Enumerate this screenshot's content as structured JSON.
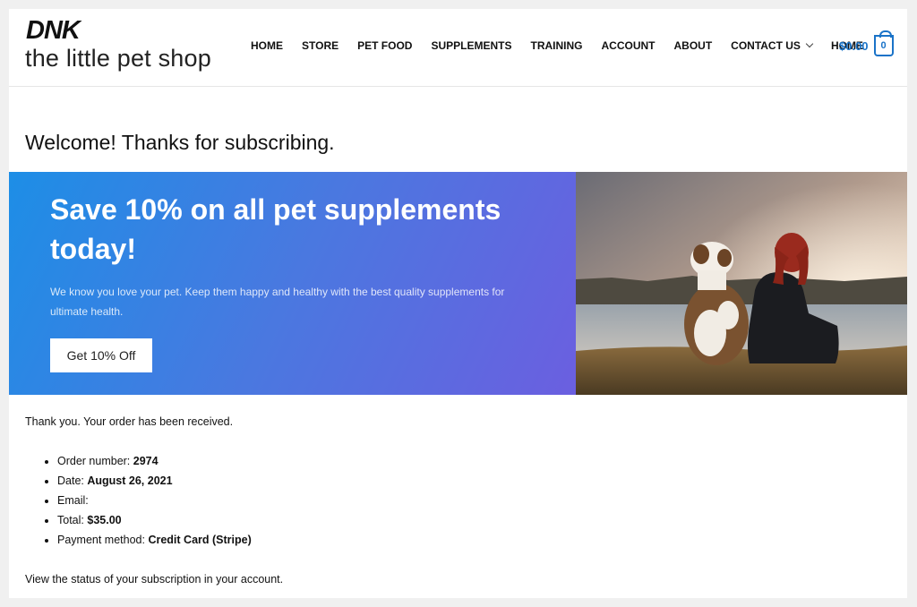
{
  "logo": {
    "text": "DNK"
  },
  "site_title": "the little pet shop",
  "nav": {
    "items": [
      "HOME",
      "STORE",
      "PET FOOD",
      "SUPPLEMENTS",
      "TRAINING",
      "ACCOUNT",
      "ABOUT",
      "CONTACT US",
      "HOME"
    ]
  },
  "cart": {
    "total": "$0.00",
    "count": "0"
  },
  "welcome_heading": "Welcome! Thanks for subscribing.",
  "banner": {
    "heading": "Save 10% on all pet supplements today!",
    "text": "We know you love your pet. Keep them happy and healthy with the best quality supplements for ultimate health.",
    "button_label": "Get 10% Off"
  },
  "order": {
    "thanks": "Thank you. Your order has been received.",
    "number_label": "Order number:",
    "number_value": "2974",
    "date_label": "Date:",
    "date_value": "August 26, 2021",
    "email_label": "Email:",
    "email_value": "",
    "total_label": "Total:",
    "total_value": "$35.00",
    "payment_label": "Payment method:",
    "payment_value": "Credit Card (Stripe)"
  },
  "status_text": "View the status of your subscription in your account.",
  "colors": {
    "accent": "#1a73c8",
    "banner_start": "#1d8ee6",
    "banner_end": "#6b5fe0"
  }
}
